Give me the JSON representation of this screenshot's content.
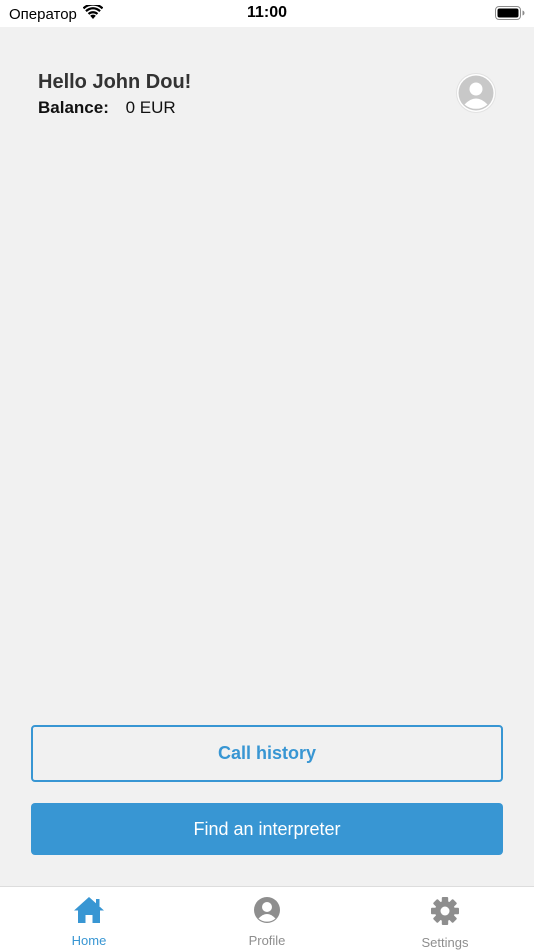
{
  "status_bar": {
    "carrier": "Оператор",
    "time": "11:00",
    "icons": [
      "wifi-icon",
      "battery-icon"
    ]
  },
  "header": {
    "greeting": "Hello John Dou!",
    "balance_label": "Balance:",
    "balance_value": "0 EUR",
    "avatar_icon": "user-avatar-icon"
  },
  "actions": {
    "call_history_label": "Call history",
    "find_interpreter_label": "Find an interpreter"
  },
  "tab_bar": {
    "active": "Home",
    "items": [
      {
        "label": "Home",
        "icon": "home-icon"
      },
      {
        "label": "Profile",
        "icon": "profile-icon"
      },
      {
        "label": "Settings",
        "icon": "gear-icon"
      }
    ]
  },
  "colors": {
    "accent": "#3896d3",
    "background": "#f1f1f1",
    "tab_inactive": "#8e8e8e"
  }
}
